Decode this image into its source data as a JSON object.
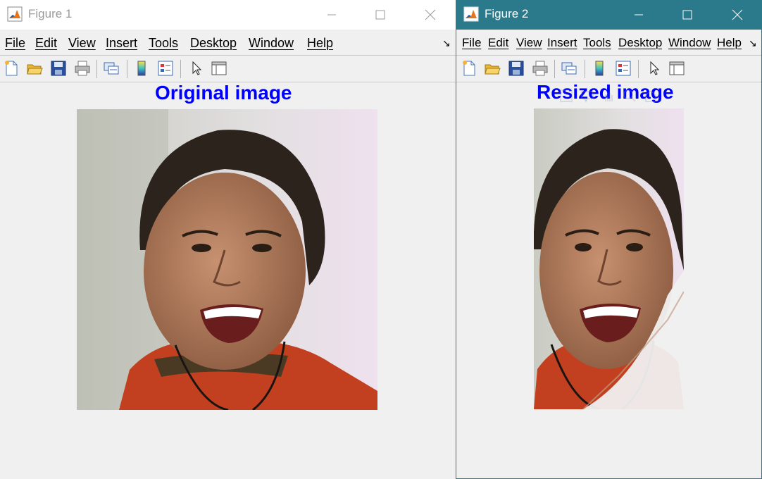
{
  "window1": {
    "title": "Figure 1",
    "menu": [
      "File",
      "Edit",
      "View",
      "Insert",
      "Tools",
      "Desktop",
      "Window",
      "Help"
    ],
    "axes_title": "Original image"
  },
  "window2": {
    "title": "Figure 2",
    "menu": [
      "File",
      "Edit",
      "View",
      "Insert",
      "Tools",
      "Desktop",
      "Window",
      "Help"
    ],
    "axes_title": "Resized image"
  },
  "icons": {
    "caption": [
      "minimize-icon",
      "maximize-icon",
      "close-icon"
    ],
    "toolbar": [
      "new-figure-icon",
      "open-file-icon",
      "save-icon",
      "print-icon",
      "link-plot-icon",
      "colorbar-icon",
      "legend-icon",
      "edit-plot-icon",
      "property-inspector-icon"
    ],
    "overflow": "menu-overflow-arrow-icon"
  },
  "colors": {
    "title_blue": "#0000ff",
    "active_titlebar": "#2b7a8c"
  }
}
